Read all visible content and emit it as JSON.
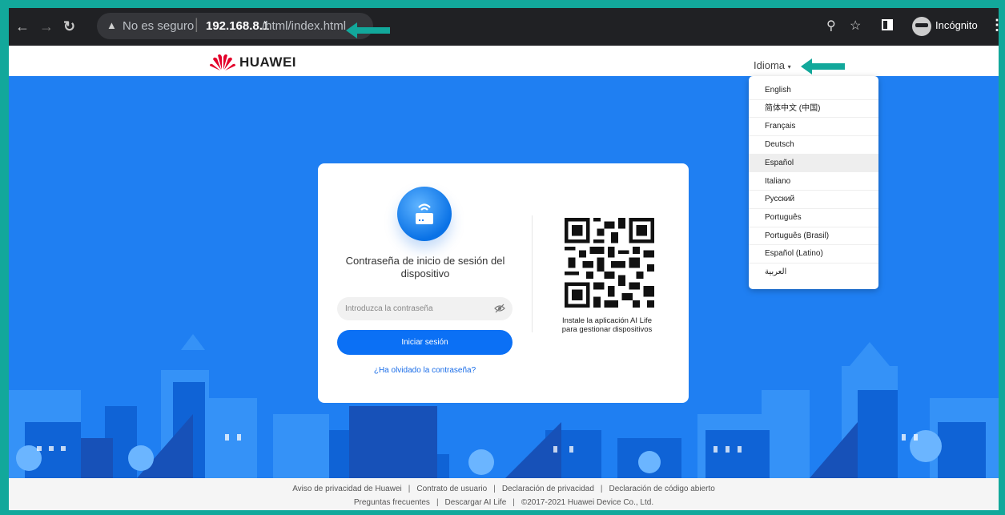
{
  "browser": {
    "security_text": "No es seguro",
    "url_host": "192.168.8.1",
    "url_path": "/html/index.html",
    "profile_label": "Incógnito"
  },
  "header": {
    "brand": "HUAWEI",
    "language_link": "Idioma"
  },
  "login": {
    "title": "Contraseña de inicio de sesión del dispositivo",
    "password_placeholder": "Introduzca la contraseña",
    "login_button": "Iniciar sesión",
    "forgot_link": "¿Ha olvidado la contraseña?",
    "qr_caption": "Instale la aplicación AI Life para gestionar dispositivos"
  },
  "language_menu": {
    "selected": "Español",
    "items": [
      "English",
      "简体中文 (中国)",
      "Français",
      "Deutsch",
      "Español",
      "Italiano",
      "Русский",
      "Português",
      "Português (Brasil)",
      "Español (Latino)",
      "العربية"
    ]
  },
  "footer": {
    "row1": [
      "Aviso de privacidad de Huawei",
      "Contrato de usuario",
      "Declaración de privacidad",
      "Declaración de código abierto"
    ],
    "row2": [
      "Preguntas frecuentes",
      "Descargar AI Life",
      "©2017-2021 Huawei Device Co., Ltd."
    ]
  },
  "colors": {
    "frame": "#12a89b",
    "page_blue": "#1f7ff2",
    "accent": "#0b70f5",
    "annotation_arrow": "#12a89b"
  }
}
